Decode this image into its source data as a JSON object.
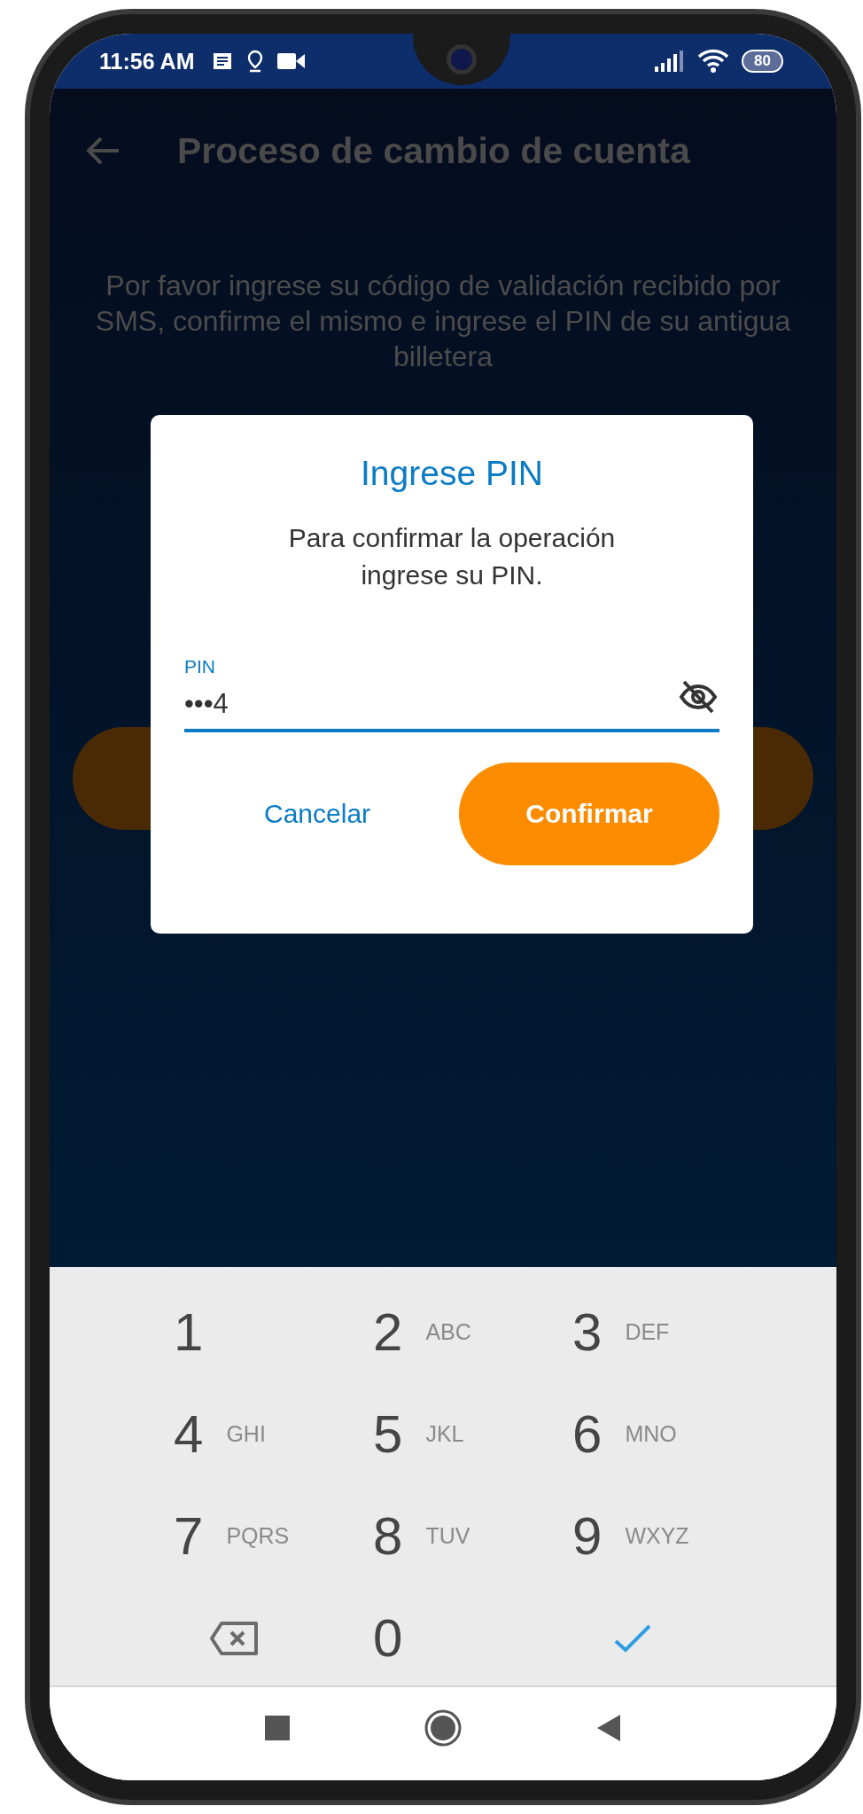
{
  "status_bar": {
    "time": "11:56 AM",
    "battery": "80"
  },
  "header": {
    "title": "Proceso de cambio de cuenta"
  },
  "instructions": "Por favor ingrese su código de validación recibido por SMS, confirme el mismo e ingrese el PIN de su antigua billetera",
  "dialog": {
    "title": "Ingrese PIN",
    "message": "Para confirmar la operación ingrese su PIN.",
    "field": {
      "label": "PIN",
      "value": "•••4"
    },
    "buttons": [
      {
        "label": "Cancelar",
        "kind": "text"
      },
      {
        "label": "Confirmar",
        "kind": "filled"
      }
    ]
  },
  "keypad": {
    "keys": [
      {
        "kind": "digit",
        "digit": "1"
      },
      {
        "kind": "digit",
        "digit": "2",
        "letters": "ABC"
      },
      {
        "kind": "digit",
        "digit": "3",
        "letters": "DEF"
      },
      {
        "kind": "digit",
        "digit": "4",
        "letters": "GHI"
      },
      {
        "kind": "digit",
        "digit": "5",
        "letters": "JKL"
      },
      {
        "kind": "digit",
        "digit": "6",
        "letters": "MNO"
      },
      {
        "kind": "digit",
        "digit": "7",
        "letters": "PQRS"
      },
      {
        "kind": "digit",
        "digit": "8",
        "letters": "TUV"
      },
      {
        "kind": "digit",
        "digit": "9",
        "letters": "WXYZ"
      },
      {
        "kind": "backspace"
      },
      {
        "kind": "digit",
        "digit": "0"
      },
      {
        "kind": "done"
      }
    ]
  }
}
